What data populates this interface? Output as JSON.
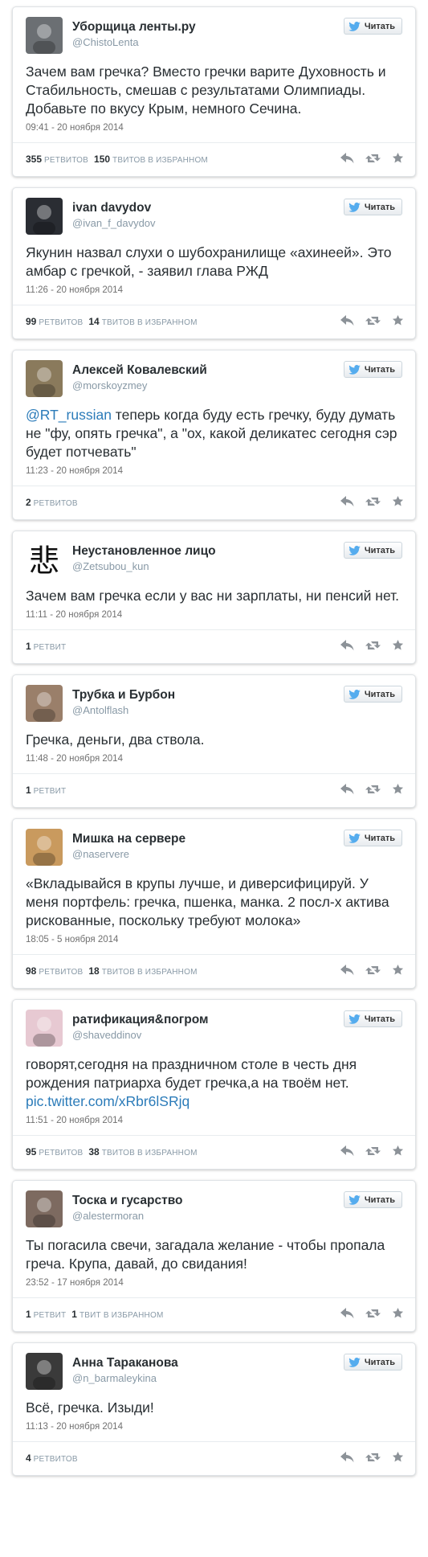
{
  "follow_label": "Читать",
  "retweets_label": "ретвитов",
  "retweet_singular_label": "ретвит",
  "favorites_label": "твитов в избранном",
  "favorite_singular_label": "твит в избранном",
  "tweets": [
    {
      "name": "Уборщица ленты.ру",
      "handle": "@ChistoLenta",
      "text": "Зачем вам гречка? Вместо гречки варите Духовность и Стабильность, смешав с результатами Олимпиады. Добавьте по вкусу Крым, немного Сечина.",
      "date": "09:41 - 20 ноября 2014",
      "retweets": "355",
      "favorites": "150",
      "avatar_color": "#6b6f73"
    },
    {
      "name": "ivan davydov",
      "handle": "@ivan_f_davydov",
      "text": "Якунин назвал слухи о шубохранилище «ахинеей». Это амбар с гречкой, - заявил глава РЖД",
      "date": "11:26 - 20 ноября 2014",
      "retweets": "99",
      "favorites": "14",
      "avatar_color": "#2a2d33"
    },
    {
      "name": "Алексей Ковалевский",
      "handle": "@morskoyzmey",
      "mention": "@RT_russian",
      "text": " теперь когда буду есть гречку, буду думать не \"фу, опять гречка\", а \"ох, какой деликатес сегодня сэр будет потчевать\"",
      "date": "11:23 - 20 ноября 2014",
      "retweets": "2",
      "avatar_color": "#8a7a5c"
    },
    {
      "name": "Неустановленное лицо",
      "handle": "@Zetsubou_kun",
      "text": "Зачем вам гречка если у вас ни зарплаты, ни пенсий нет.",
      "date": "11:11 - 20 ноября 2014",
      "retweets_single": "1",
      "avatar_glyph": "悲",
      "avatar_color": "#ffffff"
    },
    {
      "name": "Трубка и Бурбон",
      "handle": "@Antolflash",
      "text": "Гречка, деньги, два ствола.",
      "date": "11:48 - 20 ноября 2014",
      "retweets_single": "1",
      "avatar_color": "#9a7f6a"
    },
    {
      "name": "Мишка на сервере",
      "handle": "@naservere",
      "text": "«Вкладывайся в крупы лучше, и диверсифицируй. У меня портфель: гречка, пшенка, манка. 2 посл-х актива рискованные, поскольку требуют молока»",
      "date": "18:05 - 5 ноября 2014",
      "retweets": "98",
      "favorites": "18",
      "avatar_color": "#c99a5e"
    },
    {
      "name": "ратификация&погром",
      "handle": "@shaveddinov",
      "text": "говорят,сегодня на праздничном столе в честь дня рождения патриарха будет гречка,а на твоём нет. ",
      "link": "pic.twitter.com/xRbr6lSRjq",
      "date": "11:51 - 20 ноября 2014",
      "retweets": "95",
      "favorites": "38",
      "avatar_color": "#e7c9d2"
    },
    {
      "name": "Тоска и гусарство",
      "handle": "@alestermoran",
      "text": "Ты погасила свечи, загадала желание - чтобы пропала греча. Крупа, давай, до свидания!",
      "date": "23:52 - 17 ноября 2014",
      "retweets_single": "1",
      "favorites_single": "1",
      "avatar_color": "#7d6a60"
    },
    {
      "name": "Анна Тараканова",
      "handle": "@n_barmaleykina",
      "text": "Всё, гречка. Изыди!",
      "date": "11:13 - 20 ноября 2014",
      "retweets": "4",
      "avatar_color": "#3a3a3a"
    }
  ]
}
